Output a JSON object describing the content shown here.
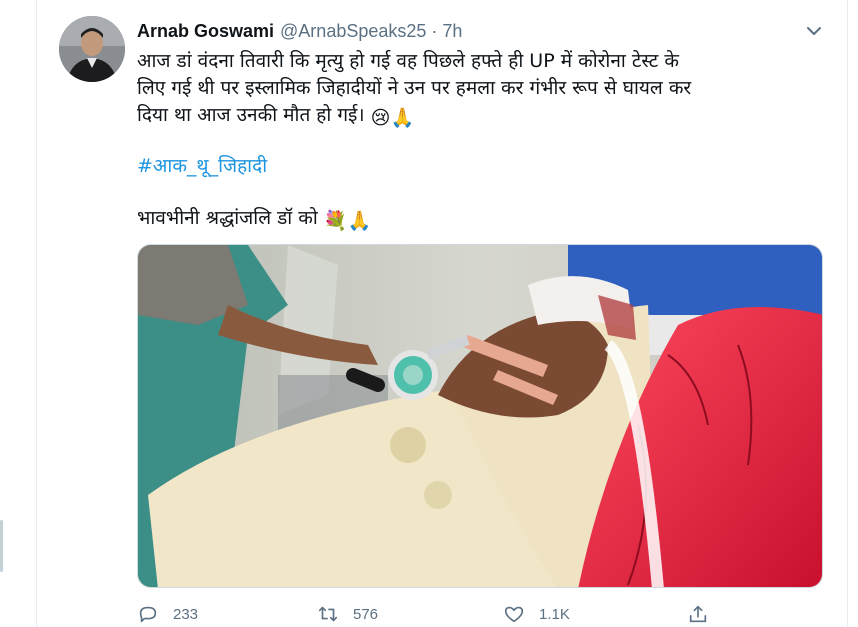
{
  "tweet": {
    "display_name": "Arnab Goswami",
    "handle": "@ArnabSpeaks25",
    "separator": "·",
    "time": "7h",
    "body_line_1": "आज डां वंदना तिवारी कि मृत्यु हो गई वह पिछले हफ्ते ही UP में कोरोना टेस्ट के",
    "body_line_2": "लिए गई थी पर इस्लामिक जिहादीयों ने उन पर हमला कर गंभीर रूप से घायल कर",
    "body_line_3": "दिया था आज उनकी मौत हो गई।",
    "body_emoji": "😢🙏",
    "hashtag": "#आक_थू_जिहादी",
    "tribute_text": "भावभीनी श्रद्धांजलि डॉ को",
    "tribute_emoji": "💐🙏"
  },
  "actions": {
    "reply_count": "233",
    "retweet_count": "576",
    "like_count": "1.1K"
  },
  "icons": {
    "more": "chevron-down-icon",
    "reply": "reply-icon",
    "retweet": "retweet-icon",
    "like": "heart-icon",
    "share": "share-icon"
  },
  "colors": {
    "link": "#1b95e0",
    "secondary_text": "#5b7083",
    "primary_text": "#0f1419",
    "border": "#e6ecf0"
  }
}
